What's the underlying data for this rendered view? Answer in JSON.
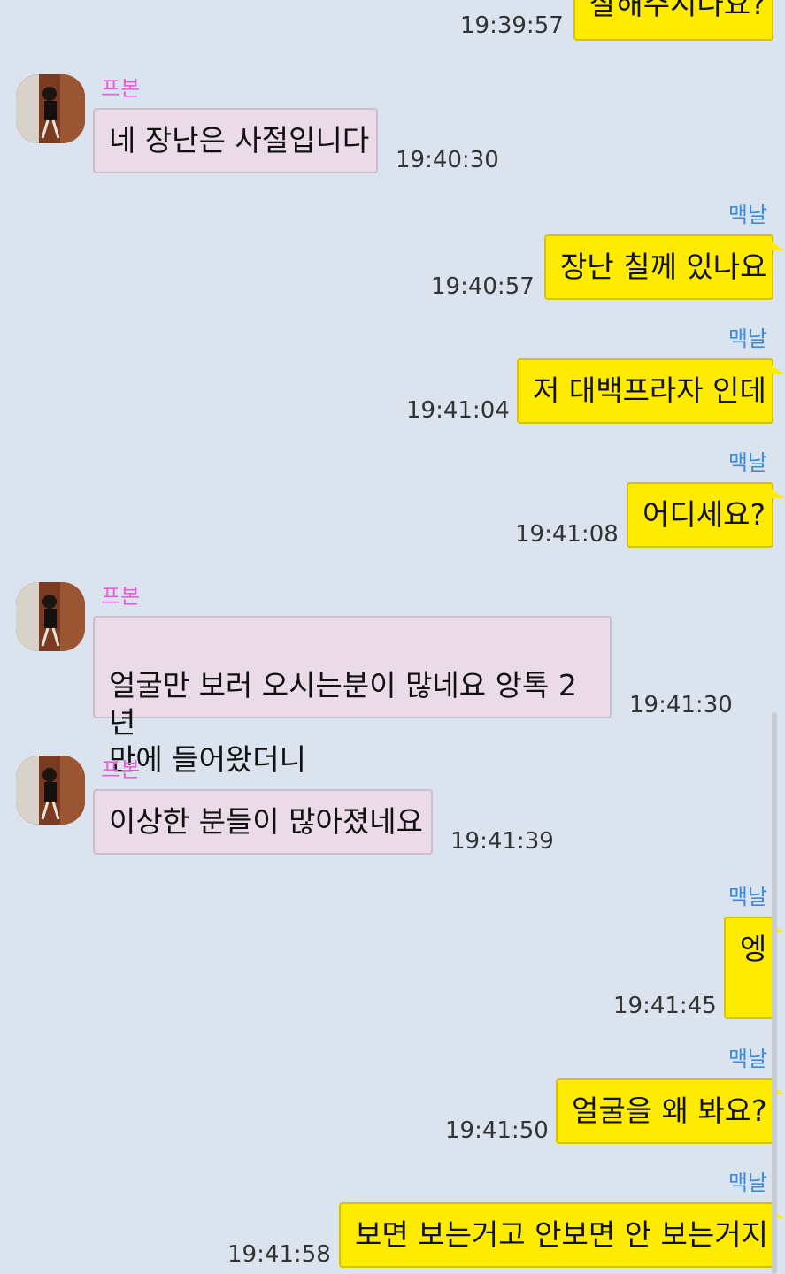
{
  "colors": {
    "background": "#dbe3ee",
    "incoming_bubble": "#ebdbe9",
    "outgoing_bubble": "#ffeb00",
    "incoming_name": "#e85fd8",
    "outgoing_name": "#3b8be0"
  },
  "contact": {
    "name": "프본",
    "avatar_icon": "profile-photo"
  },
  "me": {
    "name": "맥날"
  },
  "messages": [
    {
      "from": "me",
      "text": "잘해주시나요?",
      "time": "19:39:57"
    },
    {
      "from": "contact",
      "text": "네 장난은 사절입니다",
      "time": "19:40:30"
    },
    {
      "from": "me",
      "text": "장난 칠께 있나요",
      "time": "19:40:57"
    },
    {
      "from": "me",
      "text": "저 대백프라자 인데",
      "time": "19:41:04"
    },
    {
      "from": "me",
      "text": "어디세요?",
      "time": "19:41:08"
    },
    {
      "from": "contact",
      "text": "얼굴만 보러 오시는분이 많네요 앙톡 2년\n만에 들어왔더니",
      "time": "19:41:30"
    },
    {
      "from": "contact",
      "text": "이상한 분들이 많아졌네요",
      "time": "19:41:39"
    },
    {
      "from": "me",
      "text": "엥",
      "time": "19:41:45"
    },
    {
      "from": "me",
      "text": "얼굴을 왜 봐요?",
      "time": "19:41:50"
    },
    {
      "from": "me",
      "text": "보면 보는거고 안보면 안 보는거지",
      "time": "19:41:58"
    }
  ]
}
